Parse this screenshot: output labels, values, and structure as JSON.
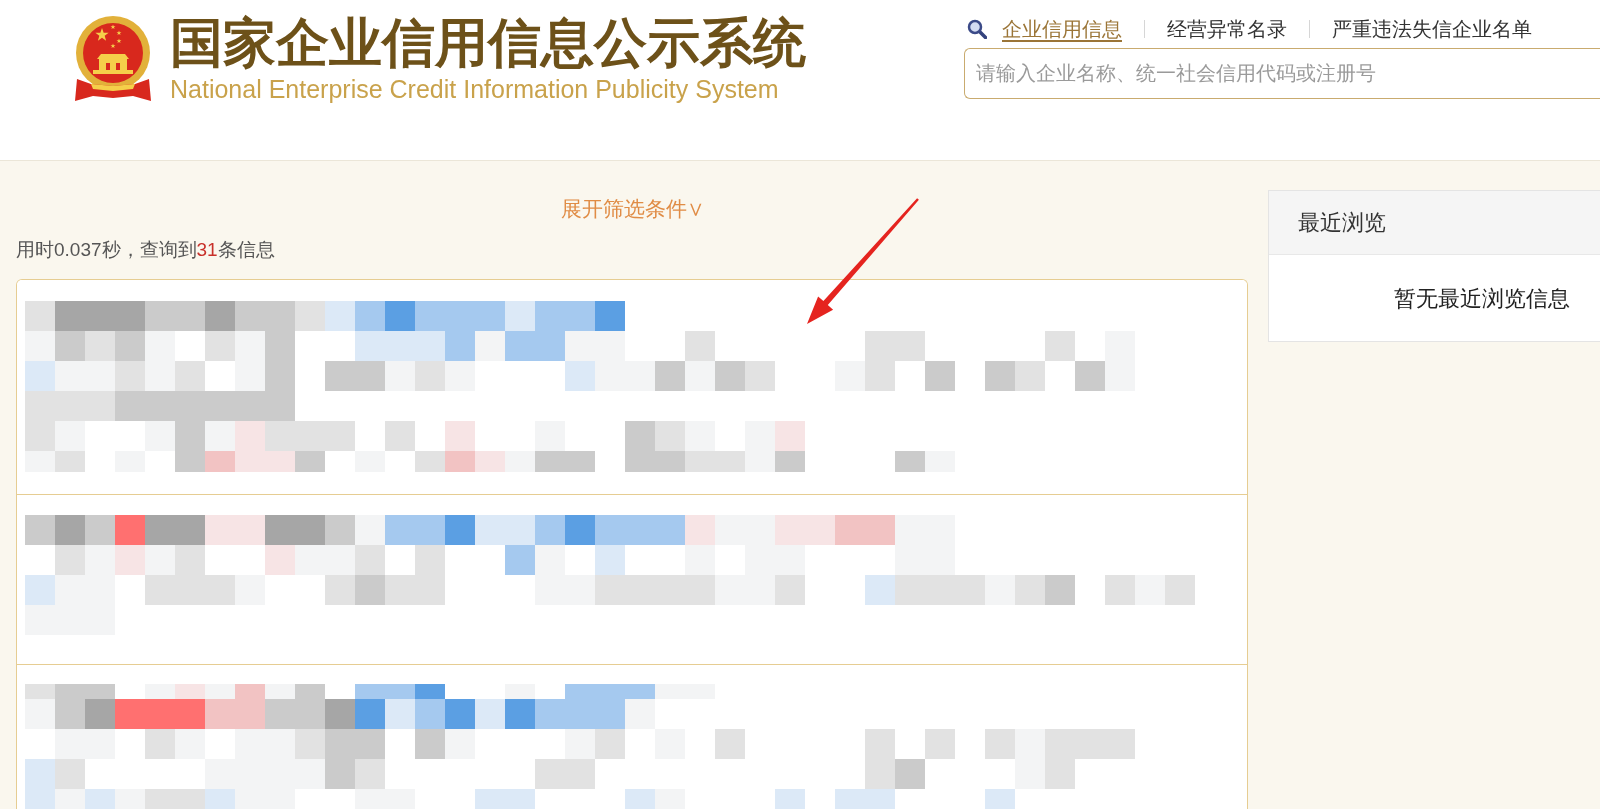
{
  "header": {
    "title": "国家企业信用信息公示系统",
    "subtitle": "National Enterprise Credit Information Publicity System",
    "nav_links": [
      {
        "label": "企业信用信息",
        "selected": true
      },
      {
        "label": "经营异常名录",
        "selected": false
      },
      {
        "label": "严重违法失信企业名单",
        "selected": false
      }
    ],
    "search": {
      "placeholder": "请输入企业名称、统一社会信用代码或注册号"
    }
  },
  "filter_toggle": {
    "label": "展开筛选条件∨"
  },
  "result_summary": {
    "prefix": "用时0.037秒，查询到",
    "count": "31",
    "suffix": "条信息"
  },
  "results": [
    {
      "kind": "pixelated"
    },
    {
      "kind": "pixelated"
    },
    {
      "kind": "pixelated"
    }
  ],
  "recent_panel": {
    "title": "最近浏览",
    "empty_message": "暂无最近浏览信息"
  }
}
